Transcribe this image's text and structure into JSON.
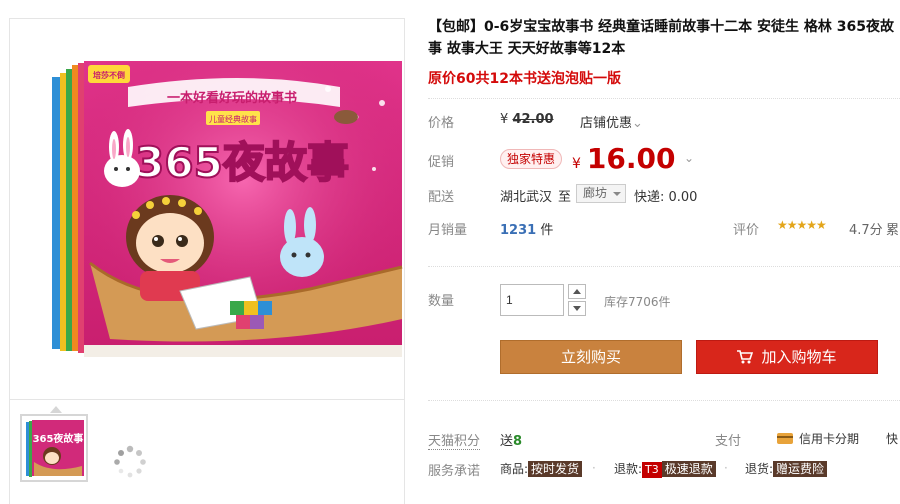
{
  "product": {
    "title": "【包邮】0-6岁宝宝故事书 经典童话睡前故事十二本 安徒生 格林 365夜故事 故事大王 天天好故事等12本",
    "subtitle": "原价60共12本书送泡泡贴一版"
  },
  "image": {
    "book_title": "365夜故事",
    "book_banner": "一本好看好玩的故事书",
    "book_tagline": "儿童经典故事",
    "publisher_badge": "培莎不倒",
    "thumb_title": "365夜故事"
  },
  "price": {
    "label": "价格",
    "currency": "¥",
    "original": "42.00",
    "coupon_label": "店铺优惠",
    "coupon_chevron": "⌄"
  },
  "promo": {
    "label": "促销",
    "badge": "独家特惠",
    "currency": "¥",
    "price": "16.00",
    "chevron": "⌄"
  },
  "shipping": {
    "label": "配送",
    "from": "湖北武汉",
    "to_label": "至",
    "destination": "廊坊",
    "express": "快递: 0.00"
  },
  "sales": {
    "label": "月销量",
    "count": "1231",
    "unit": "件",
    "rating_label": "评价",
    "stars": "★★★★★",
    "rating_value": "4.7分",
    "rating_more": "累"
  },
  "quantity": {
    "label": "数量",
    "value": "1",
    "stock": "库存7706件"
  },
  "buttons": {
    "buy_now": "立刻购买",
    "add_cart": "加入购物车"
  },
  "points": {
    "label": "天猫积分",
    "give": "送",
    "value": "8",
    "pay_label": "支付",
    "pay_item": "信用卡分期",
    "pay_more": "快"
  },
  "service": {
    "label": "服务承诺",
    "goods_label": "商品:",
    "goods_tag": "按时发货",
    "refund_label": "退款:",
    "refund_t3": "T3",
    "refund_tag": "极速退款",
    "return_label": "退货:",
    "return_tag": "赠运费险"
  },
  "colors": {
    "accent_red": "#c40000",
    "buy_orange": "#c9823e",
    "cart_red": "#d8261b",
    "link_blue": "#3a6fb5"
  }
}
